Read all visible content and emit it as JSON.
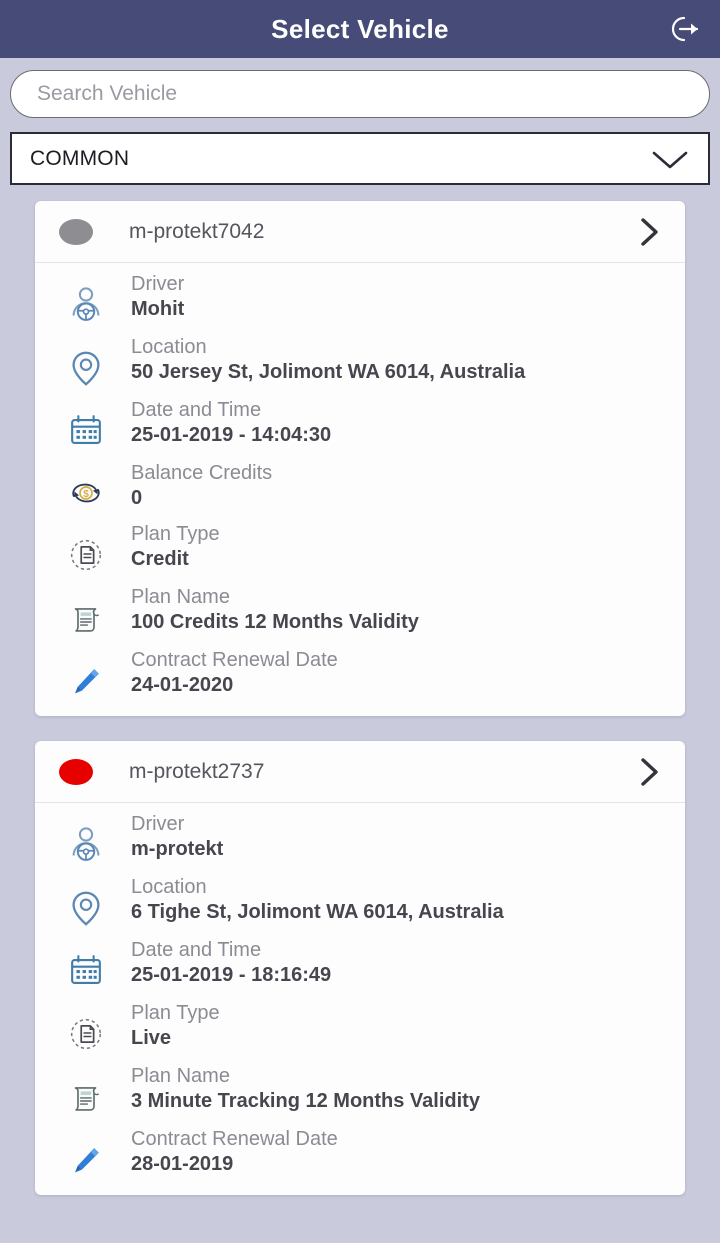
{
  "header": {
    "title": "Select Vehicle",
    "logout_icon": "logout-icon",
    "background_color": "#474b78",
    "title_color": "#ffffff"
  },
  "search": {
    "placeholder": "Search Vehicle",
    "value": ""
  },
  "group_select": {
    "selected": "COMMON",
    "chevron_icon": "chevron-down-icon"
  },
  "labels": {
    "driver": "Driver",
    "location": "Location",
    "date_and_time": "Date and Time",
    "balance_credits": "Balance Credits",
    "plan_type": "Plan Type",
    "plan_name": "Plan Name",
    "contract_renewal_date": "Contract Renewal Date"
  },
  "vehicles": [
    {
      "name": "m-protekt7042",
      "status_color": "#8e8e92",
      "status_name": "offline",
      "chevron_icon": "chevron-right-icon",
      "rows": [
        {
          "icon": "driver-icon",
          "label": "Driver",
          "value": "Mohit"
        },
        {
          "icon": "location-icon",
          "label": "Location",
          "value": "50 Jersey St, Jolimont WA 6014, Australia"
        },
        {
          "icon": "calendar-icon",
          "label": "Date and Time",
          "value": "25-01-2019 - 14:04:30"
        },
        {
          "icon": "credits-icon",
          "label": "Balance Credits",
          "value": "0"
        },
        {
          "icon": "plan-type-icon",
          "label": "Plan Type",
          "value": "Credit"
        },
        {
          "icon": "plan-name-icon",
          "label": "Plan Name",
          "value": "100 Credits 12 Months Validity"
        },
        {
          "icon": "pencil-icon",
          "label": "Contract Renewal Date",
          "value": "24-01-2020"
        }
      ]
    },
    {
      "name": "m-protekt2737",
      "status_color": "#e60000",
      "status_name": "alert",
      "chevron_icon": "chevron-right-icon",
      "rows": [
        {
          "icon": "driver-icon",
          "label": "Driver",
          "value": "m-protekt"
        },
        {
          "icon": "location-icon",
          "label": "Location",
          "value": "6 Tighe St, Jolimont WA 6014, Australia"
        },
        {
          "icon": "calendar-icon",
          "label": "Date and Time",
          "value": "25-01-2019 - 18:16:49"
        },
        {
          "icon": "plan-type-icon",
          "label": "Plan Type",
          "value": "Live"
        },
        {
          "icon": "plan-name-icon",
          "label": "Plan Name",
          "value": "3 Minute Tracking 12 Months Validity"
        },
        {
          "icon": "pencil-icon",
          "label": "Contract Renewal Date",
          "value": "28-01-2019"
        }
      ]
    }
  ]
}
